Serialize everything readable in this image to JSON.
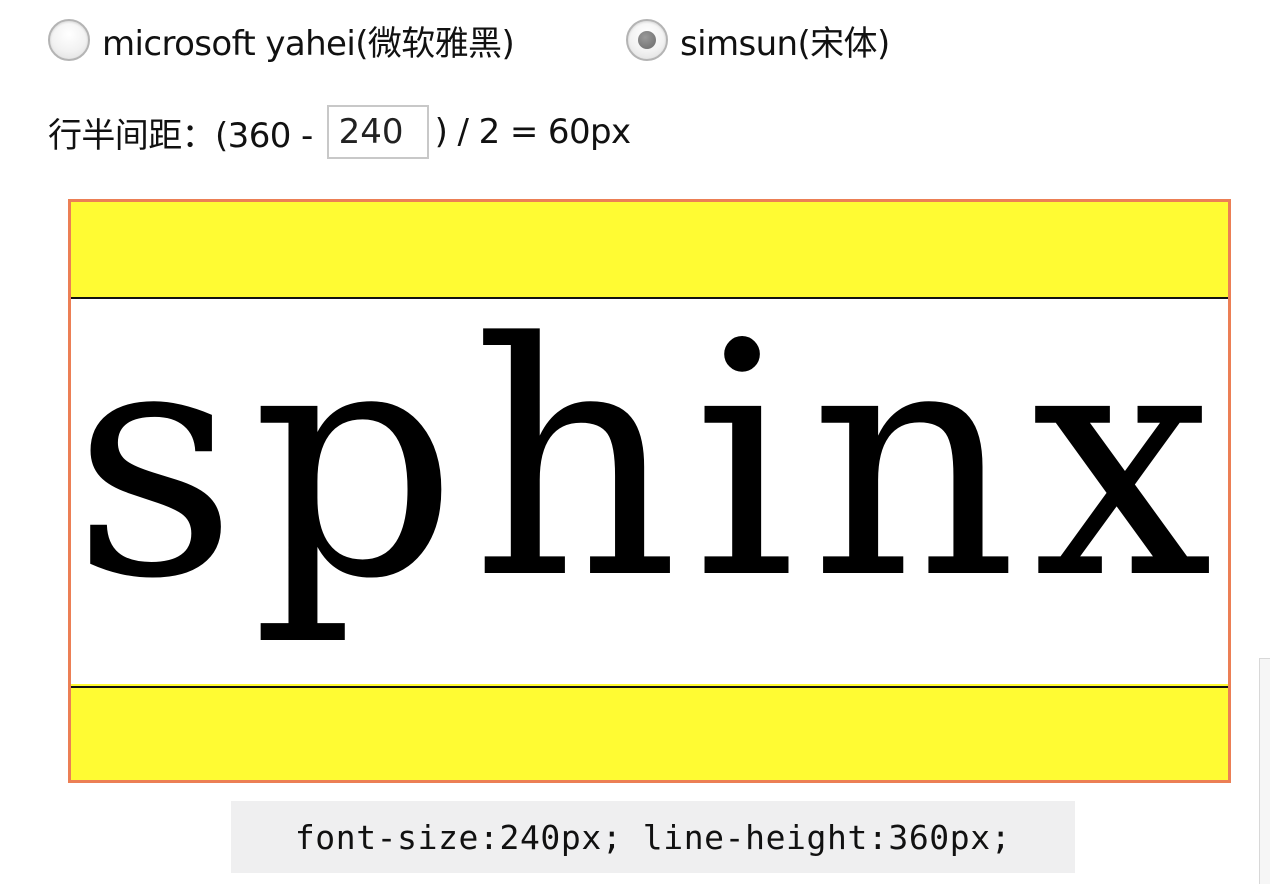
{
  "font_options": [
    {
      "label": "microsoft yahei(微软雅黑)",
      "selected": false
    },
    {
      "label": "simsun(宋体)",
      "selected": true
    }
  ],
  "formula": {
    "label": "行半间距：(360 -",
    "font_size_value": "240",
    "result": ") / 2 = 60px"
  },
  "demo": {
    "sample_text": "sphinx",
    "band_color": "#fffb33",
    "border_color": "#ec7f55"
  },
  "code_caption": "font-size:240px; line-height:360px;"
}
